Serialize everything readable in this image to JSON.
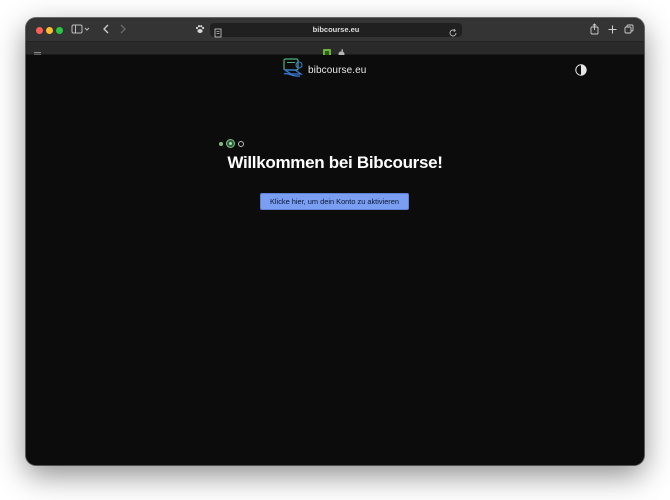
{
  "browser": {
    "url": "bibcourse.eu",
    "icons": {
      "sidebar": "sidebar-icon",
      "back": "chevron-left-icon",
      "forward": "chevron-right-icon",
      "extension": "paw-icon",
      "page_menu": "page-menu-icon",
      "reload": "reload-icon",
      "share": "share-icon",
      "new_tab": "plus-icon",
      "tab_overview": "tab-overview-icon"
    }
  },
  "page": {
    "logo_text": "bibcourse.eu",
    "welcome_heading": "Willkommen bei Bibcourse!",
    "activate_button_label": "Klicke hier, um dein Konto zu aktivieren",
    "steps": {
      "total": 3,
      "completed": 1,
      "current": 2
    }
  },
  "colors": {
    "page_background": "#0c0c0c",
    "button_background": "#7a9ef2",
    "step_completed": "#7fbf7f",
    "logo_green": "#4caf7d",
    "logo_blue": "#3a7bd5"
  }
}
